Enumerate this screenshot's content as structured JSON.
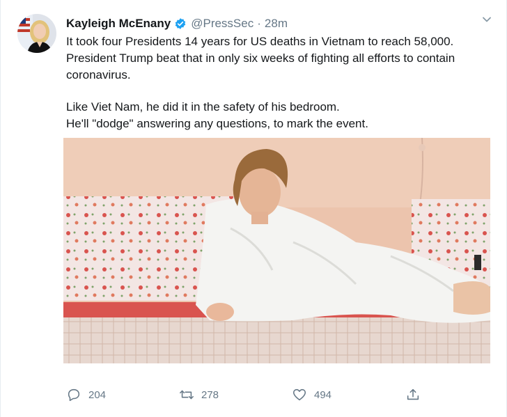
{
  "tweet": {
    "display_name": "Kayleigh McEnany",
    "handle": "@PressSec",
    "separator": "·",
    "timestamp": "28m",
    "text_lines_p1": [
      "It took four Presidents 14 years for US deaths in Vietnam to reach 58,000.",
      "President Trump beat that in only six weeks of fighting all efforts to contain",
      "coronavirus."
    ],
    "text_lines_p2": [
      "Like Viet Nam, he did it in the safety of his bedroom.",
      "He'll \"dodge\" answering any questions, to mark the event."
    ],
    "actions": {
      "replies": "204",
      "retweets": "278",
      "likes": "494"
    }
  },
  "colors": {
    "verified": "#1da1f2",
    "muted": "#657786",
    "text": "#14171a"
  },
  "icons": {
    "avatar": "avatar",
    "verified": "verified-badge-icon",
    "menu": "chevron-down-icon",
    "reply": "reply-icon",
    "retweet": "retweet-icon",
    "like": "heart-icon",
    "share": "share-icon"
  }
}
